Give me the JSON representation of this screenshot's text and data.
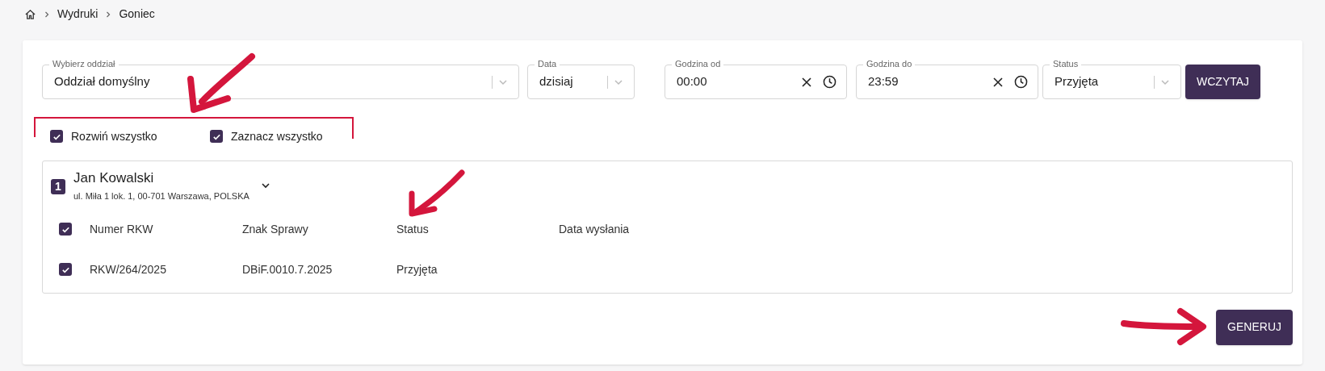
{
  "breadcrumb": [
    "Wydruki",
    "Goniec"
  ],
  "filters": [
    {
      "kind": "select",
      "label": "Wybierz oddział",
      "value": "Oddział domyślny"
    },
    {
      "kind": "select",
      "label": "Data",
      "value": "dzisiaj"
    },
    {
      "kind": "time",
      "label": "Godzina od",
      "value": "00:00"
    },
    {
      "kind": "time",
      "label": "Godzina do",
      "value": "23:59"
    },
    {
      "kind": "select",
      "label": "Status",
      "value": "Przyjęta"
    }
  ],
  "load_button": "WCZYTAJ",
  "options": [
    {
      "label": "Rozwiń wszystko",
      "checked": true
    },
    {
      "label": "Zaznacz wszystko",
      "checked": true
    }
  ],
  "groups": [
    {
      "number": "1",
      "name": "Jan Kowalski",
      "address": "ul. Miła 1 lok. 1, 00-701 Warszawa, POLSKA",
      "expanded": true,
      "header_checked": true,
      "columns": [
        "Numer RKW",
        "Znak Sprawy",
        "Status",
        "Data wysłania"
      ],
      "rows": [
        {
          "checked": true,
          "cells": [
            "RKW/264/2025",
            "DBiF.0010.7.2025",
            "Przyjęta",
            ""
          ]
        }
      ]
    }
  ],
  "generate_button": "GENERUJ"
}
